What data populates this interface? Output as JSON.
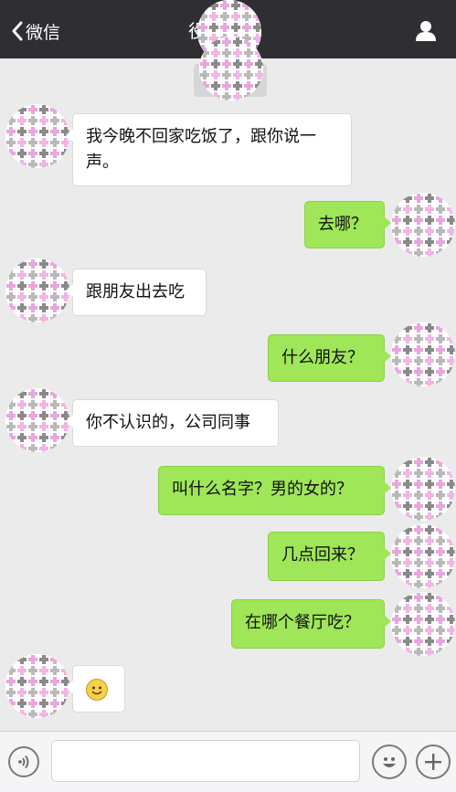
{
  "header": {
    "back_label": "微信",
    "title": "役",
    "icons": {
      "back": "chevron-left-icon",
      "contact": "person-icon"
    }
  },
  "colors": {
    "titlebar": "#2e2e33",
    "chat_background": "#ebebeb",
    "outgoing_bubble": "#9fe658",
    "incoming_bubble": "#ffffff"
  },
  "messages": [
    {
      "sender": "contact",
      "text": "我今晚不回家吃饭了，跟你说一声。"
    },
    {
      "sender": "me",
      "text": "去哪？"
    },
    {
      "sender": "contact",
      "text": "跟朋友出去吃"
    },
    {
      "sender": "me",
      "text": "什么朋友？"
    },
    {
      "sender": "contact",
      "text": "你不认识的，公司同事"
    },
    {
      "sender": "me",
      "text": "叫什么名字？男的女的？"
    },
    {
      "sender": "me",
      "text": "几点回来？"
    },
    {
      "sender": "me",
      "text": "在哪个餐厅吃？"
    },
    {
      "sender": "contact",
      "text": "",
      "emoji": "smiley-emoji"
    }
  ],
  "input_bar": {
    "text_value": "",
    "icons": {
      "voice": "voice-icon",
      "emoji": "emoji-face-icon",
      "more": "plus-icon"
    }
  }
}
